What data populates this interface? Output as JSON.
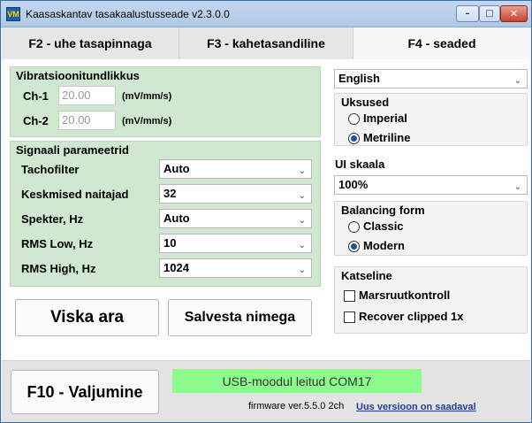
{
  "window": {
    "title": "Kaasaskantav tasakaalustusseade v2.3.0.0",
    "app_icon_text": "VM"
  },
  "titlebar_buttons": {
    "minimize": "–",
    "maximize": "□",
    "close": "✕"
  },
  "tabs": [
    {
      "label": "F2 - uhe tasapinnaga",
      "selected": false
    },
    {
      "label": "F3 - kahetasandiline",
      "selected": false
    },
    {
      "label": "F4 - seaded",
      "selected": true
    }
  ],
  "sensitivity": {
    "title": "Vibratsioonitundlikkus",
    "ch1": {
      "label": "Ch-1",
      "value": "20.00",
      "unit": "(mV/mm/s)"
    },
    "ch2": {
      "label": "Ch-2",
      "value": "20.00",
      "unit": "(mV/mm/s)"
    }
  },
  "signal": {
    "title": "Signaali parameetrid",
    "rows": [
      {
        "label": "Tachofilter",
        "value": "Auto"
      },
      {
        "label": "Keskmised naitajad",
        "value": "32"
      },
      {
        "label": "Spekter, Hz",
        "value": "Auto"
      },
      {
        "label": "RMS Low, Hz",
        "value": "10"
      },
      {
        "label": "RMS High, Hz",
        "value": "1024"
      }
    ]
  },
  "buttons": {
    "discard": "Viska ara",
    "save_as": "Salvesta nimega",
    "exit": "F10 - Valjumine"
  },
  "language": {
    "value": "English"
  },
  "units": {
    "title": "Uksused",
    "options": [
      "Imperial",
      "Metriline"
    ],
    "selected": "Metriline"
  },
  "ui_scale": {
    "title": "UI skaala",
    "value": "100%"
  },
  "balancing_form": {
    "title": "Balancing form",
    "options": [
      "Classic",
      "Modern"
    ],
    "selected": "Modern"
  },
  "katseline": {
    "title": "Katseline",
    "checks": [
      {
        "label": "Marsruutkontroll",
        "checked": false
      },
      {
        "label": "Recover clipped 1x",
        "checked": false
      }
    ]
  },
  "footer": {
    "status": "USB-moodul leitud COM17",
    "firmware": "firmware ver.5.5.0 2ch",
    "update_link": "Uus versioon on saadaval"
  },
  "colors": {
    "panel_green": "#cfe8cf",
    "status_green": "#8cfc8c",
    "link_blue": "#1a3fa8"
  }
}
